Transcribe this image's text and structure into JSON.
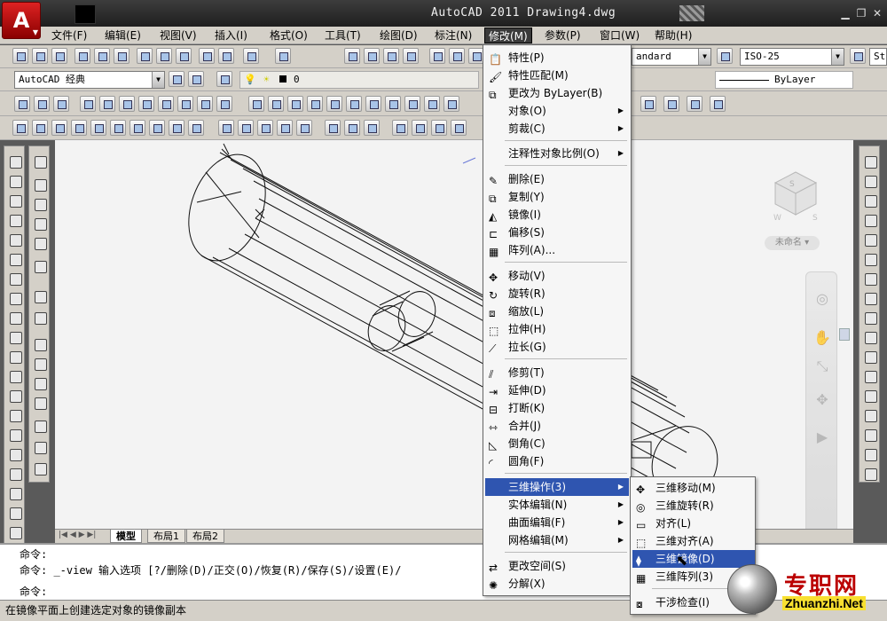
{
  "window": {
    "title": "AutoCAD 2011    Drawing4.dwg",
    "logo_letter": "A"
  },
  "menubar": {
    "items": [
      "文件(F)",
      "编辑(E)",
      "视图(V)",
      "插入(I)",
      "格式(O)",
      "工具(T)",
      "绘图(D)",
      "标注(N)",
      "修改(M)",
      "参数(P)",
      "窗口(W)",
      "帮助(H)"
    ],
    "active": "修改(M)"
  },
  "toolbar": {
    "workspace_combo": "AutoCAD 经典",
    "layer_combo": "0",
    "text_style_combo": "andard",
    "dim_style_combo": "ISO-25",
    "table_style_combo": "St",
    "linetype_combo": "ByLayer"
  },
  "viewcube": {
    "unnamed_label": "未命名"
  },
  "tabs": {
    "items": [
      "模型",
      "布局1",
      "布局2"
    ],
    "active": "模型"
  },
  "command": {
    "line1": "命令:",
    "line2": "命令: _-view 输入选项 [?/删除(D)/正交(O)/恢复(R)/保存(S)/设置(E)/",
    "line3": "命令:"
  },
  "status_bar": {
    "text": "在镜像平面上创建选定对象的镜像副本"
  },
  "modify_menu": {
    "items": [
      {
        "label": "特性(P)",
        "icon": "properties-icon"
      },
      {
        "label": "特性匹配(M)",
        "icon": "match-properties-icon"
      },
      {
        "label": "更改为 ByLayer(B)",
        "icon": "bylayer-icon"
      },
      {
        "label": "对象(O)",
        "submenu": true
      },
      {
        "label": "剪裁(C)",
        "submenu": true
      },
      {
        "label": "注释性对象比例(O)",
        "submenu": true
      },
      {
        "label": "删除(E)",
        "icon": "eraser-icon"
      },
      {
        "label": "复制(Y)",
        "icon": "copy-icon"
      },
      {
        "label": "镜像(I)",
        "icon": "mirror-icon"
      },
      {
        "label": "偏移(S)",
        "icon": "offset-icon"
      },
      {
        "label": "阵列(A)...",
        "icon": "array-icon"
      },
      {
        "label": "移动(V)",
        "icon": "move-icon"
      },
      {
        "label": "旋转(R)",
        "icon": "rotate-icon"
      },
      {
        "label": "缩放(L)",
        "icon": "scale-icon"
      },
      {
        "label": "拉伸(H)",
        "icon": "stretch-icon"
      },
      {
        "label": "拉长(G)",
        "icon": "lengthen-icon"
      },
      {
        "label": "修剪(T)",
        "icon": "trim-icon"
      },
      {
        "label": "延伸(D)",
        "icon": "extend-icon"
      },
      {
        "label": "打断(K)",
        "icon": "break-icon"
      },
      {
        "label": "合并(J)",
        "icon": "join-icon"
      },
      {
        "label": "倒角(C)",
        "icon": "chamfer-icon"
      },
      {
        "label": "圆角(F)",
        "icon": "fillet-icon"
      },
      {
        "label": "三维操作(3)",
        "submenu": true,
        "highlighted": true
      },
      {
        "label": "实体编辑(N)",
        "submenu": true
      },
      {
        "label": "曲面编辑(F)",
        "submenu": true
      },
      {
        "label": "网格编辑(M)",
        "submenu": true
      },
      {
        "label": "更改空间(S)",
        "icon": "change-space-icon"
      },
      {
        "label": "分解(X)",
        "icon": "explode-icon"
      }
    ]
  },
  "sub_menu": {
    "items": [
      {
        "label": "三维移动(M)",
        "icon": "3d-move-icon"
      },
      {
        "label": "三维旋转(R)",
        "icon": "3d-rotate-icon"
      },
      {
        "label": "对齐(L)",
        "icon": "align-icon"
      },
      {
        "label": "三维对齐(A)",
        "icon": "3d-align-icon"
      },
      {
        "label": "三维镜像(D)",
        "icon": "3d-mirror-icon",
        "highlighted": true
      },
      {
        "label": "三维阵列(3)",
        "icon": "3d-array-icon"
      },
      {
        "label": "干涉检查(I)",
        "icon": "interference-icon"
      }
    ]
  },
  "watermark": {
    "cn": "专职网",
    "en": "Zhuanzhi.Net"
  }
}
